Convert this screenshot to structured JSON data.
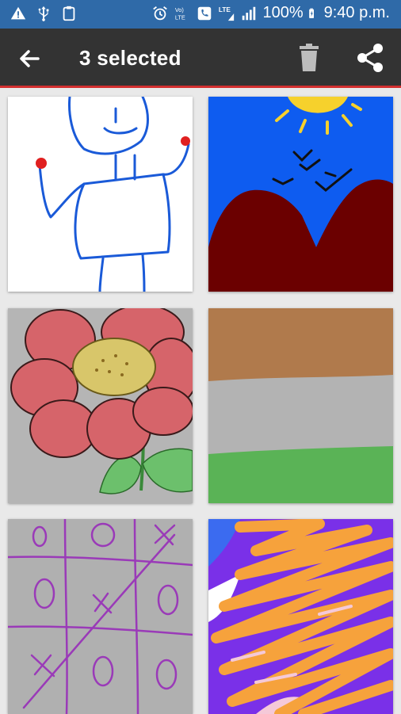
{
  "status_bar": {
    "battery": "100%",
    "time": "9:40 p.m.",
    "icons": [
      "warning-icon",
      "usb-icon",
      "clipboard-icon",
      "alarm-icon",
      "volte-icon",
      "call-icon",
      "lte-icon",
      "signal-icon",
      "battery-charging-icon"
    ]
  },
  "app_bar": {
    "title": "3 selected",
    "back_icon": "arrow-back-icon",
    "delete_icon": "trash-icon",
    "share_icon": "share-icon",
    "colors": {
      "background": "#333333",
      "accent_line": "#d32f2f"
    }
  },
  "gallery": {
    "items": [
      {
        "name": "stick-figure-drawing"
      },
      {
        "name": "mountains-sun-birds-drawing"
      },
      {
        "name": "flower-drawing"
      },
      {
        "name": "tricolor-stripes-drawing"
      },
      {
        "name": "tic-tac-toe-drawing"
      },
      {
        "name": "orange-scribble-drawing"
      }
    ]
  }
}
